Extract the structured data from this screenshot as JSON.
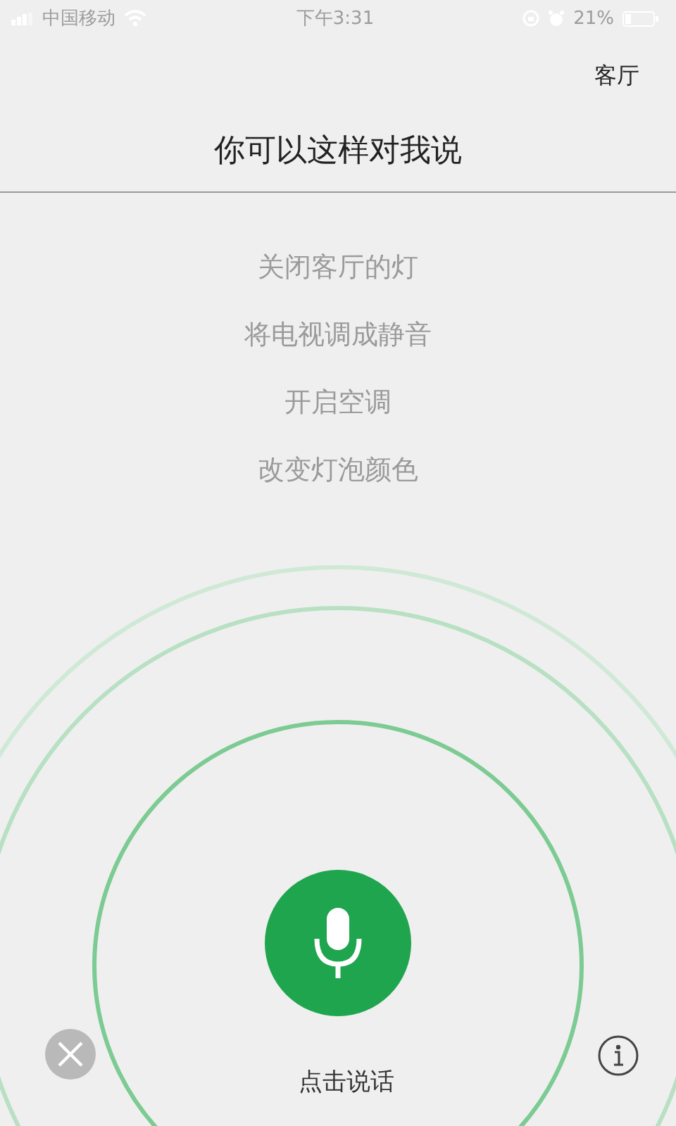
{
  "status_bar": {
    "carrier": "中国移动",
    "time": "下午3:31",
    "battery": "21%"
  },
  "room": "客厅",
  "title": "你可以这样对我说",
  "suggestions": [
    "关闭客厅的灯",
    "将电视调成静音",
    "开启空调",
    "改变灯泡颜色"
  ],
  "talk_label": "点击说话"
}
